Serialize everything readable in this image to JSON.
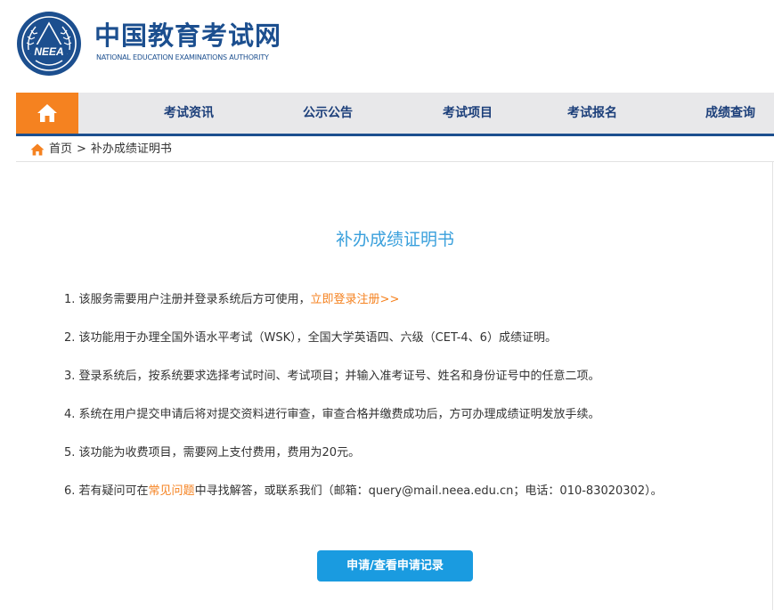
{
  "header": {
    "logo_emblem_text": "NEEA",
    "logo_cn": "中国教育考试网",
    "logo_en": "NATIONAL EDUCATION EXAMINATIONS AUTHORITY"
  },
  "nav": {
    "home_icon": "home-icon",
    "items": [
      {
        "label": "考试资讯"
      },
      {
        "label": "公示公告"
      },
      {
        "label": "考试项目"
      },
      {
        "label": "考试报名"
      },
      {
        "label": "成绩查询"
      }
    ]
  },
  "breadcrumb": {
    "home": "首页",
    "separator": ">",
    "current": "补办成绩证明书"
  },
  "main": {
    "title": "补办成绩证明书",
    "items": [
      {
        "prefix": "1. 该服务需要用户注册并登录系统后方可使用，",
        "link": "立即登录注册>>",
        "suffix": ""
      },
      {
        "prefix": "2. 该功能用于办理全国外语水平考试（WSK），全国大学英语四、六级（CET-4、6）成绩证明。",
        "link": "",
        "suffix": ""
      },
      {
        "prefix": "3. 登录系统后，按系统要求选择考试时间、考试项目；并输入准考证号、姓名和身份证号中的任意二项。",
        "link": "",
        "suffix": ""
      },
      {
        "prefix": "4. 系统在用户提交申请后将对提交资料进行审查，审查合格并缴费成功后，方可办理成绩证明发放手续。",
        "link": "",
        "suffix": ""
      },
      {
        "prefix": "5. 该功能为收费项目，需要网上支付费用，费用为20元。",
        "link": "",
        "suffix": ""
      },
      {
        "prefix": "6. 若有疑问可在",
        "link": "常见问题",
        "suffix": "中寻找解答，或联系我们（邮箱：query@mail.neea.edu.cn；电话：010-83020302）。"
      }
    ],
    "apply_button": "申请/查看申请记录"
  },
  "colors": {
    "brand_blue": "#1c4f8f",
    "accent_orange": "#f58220",
    "title_blue": "#3aa0dc",
    "button_blue": "#1a9be0"
  }
}
